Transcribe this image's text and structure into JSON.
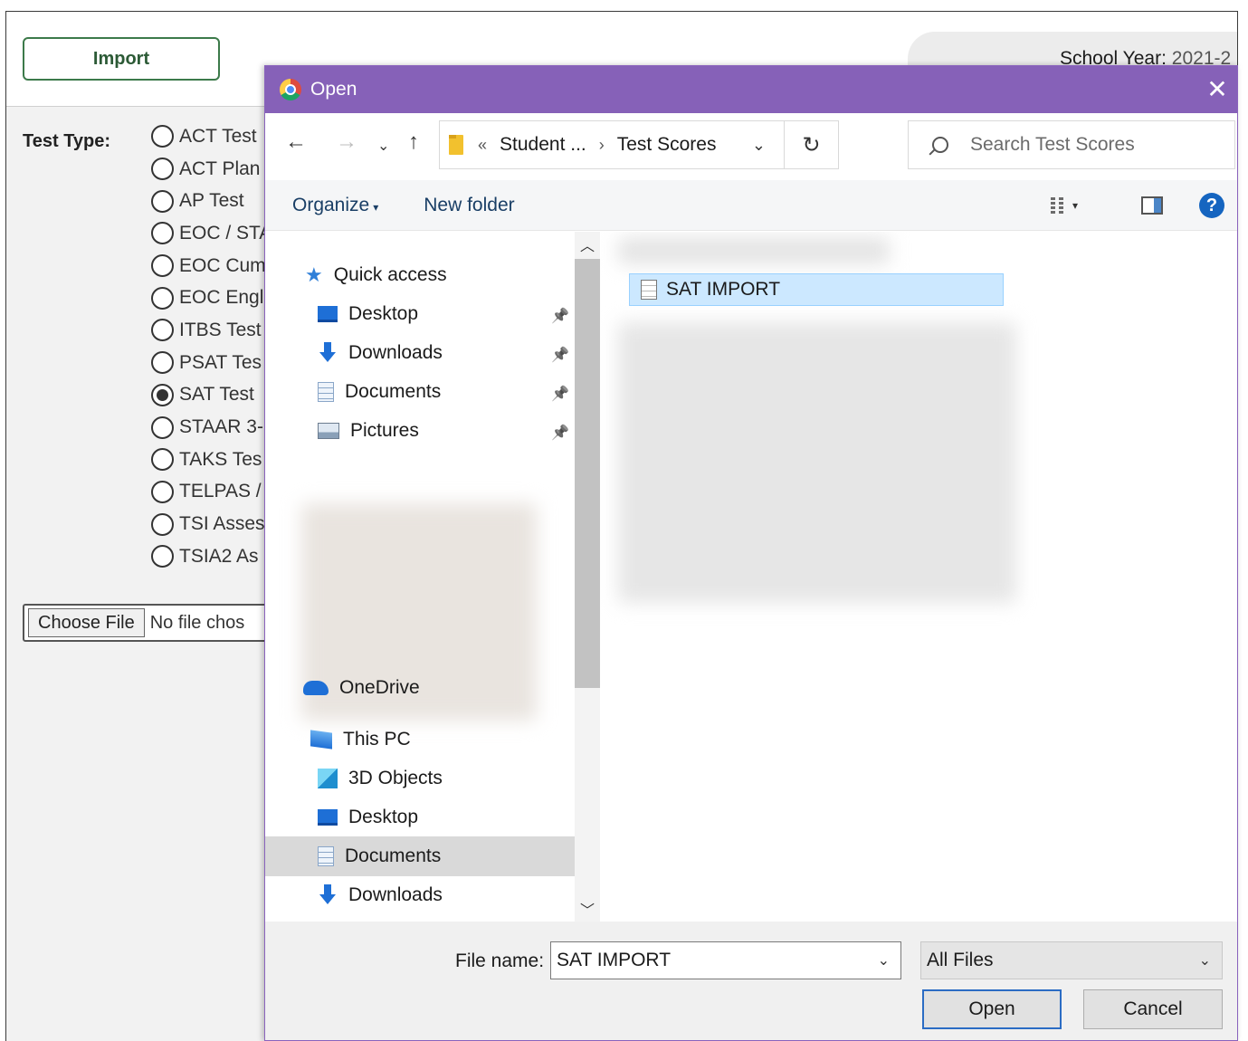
{
  "background_page": {
    "import_button": "Import",
    "school_year_label": "School Year:",
    "school_year_value": "2021-2",
    "test_type_label": "Test Type:",
    "test_types": [
      {
        "label": "ACT Test",
        "selected": false
      },
      {
        "label": "ACT Plan",
        "selected": false
      },
      {
        "label": "AP Test",
        "selected": false
      },
      {
        "label": "EOC / STA",
        "selected": false
      },
      {
        "label": "EOC Cum",
        "selected": false
      },
      {
        "label": "EOC Engl",
        "selected": false
      },
      {
        "label": "ITBS Test",
        "selected": false
      },
      {
        "label": "PSAT Tes",
        "selected": false
      },
      {
        "label": "SAT Test",
        "selected": true
      },
      {
        "label": "STAAR 3-",
        "selected": false
      },
      {
        "label": "TAKS Tes",
        "selected": false
      },
      {
        "label": "TELPAS /",
        "selected": false
      },
      {
        "label": "TSI Asses",
        "selected": false
      },
      {
        "label": "TSIA2 As",
        "selected": false
      }
    ],
    "choose_file_button": "Choose File",
    "no_file_text": "No file chos"
  },
  "dialog": {
    "title": "Open",
    "close_glyph": "✕",
    "address": {
      "back_glyph": "←",
      "forward_glyph": "→",
      "recent_glyph": "⌄",
      "up_glyph": "↑",
      "overflow_glyph": "«",
      "parent_crumb": "Student ...",
      "separator_glyph": "›",
      "current_crumb": "Test Scores",
      "dropdown_glyph": "⌄",
      "refresh_glyph": "↻"
    },
    "search_placeholder": "Search Test Scores",
    "command_bar": {
      "organize": "Organize",
      "organize_caret": "▾",
      "new_folder": "New folder",
      "view_caret": "▾",
      "help_glyph": "?"
    },
    "nav_pane": {
      "quick_access": "Quick access",
      "quick_access_items": [
        {
          "label": "Desktop",
          "icon": "desktop-icon",
          "pinned": true
        },
        {
          "label": "Downloads",
          "icon": "downloads-icon",
          "pinned": true
        },
        {
          "label": "Documents",
          "icon": "documents-icon",
          "pinned": true
        },
        {
          "label": "Pictures",
          "icon": "pictures-icon",
          "pinned": true
        }
      ],
      "pin_glyph": "📌",
      "onedrive": "OneDrive",
      "this_pc": "This PC",
      "this_pc_items": [
        {
          "label": "3D Objects",
          "icon": "3d-objects-icon",
          "selected": false
        },
        {
          "label": "Desktop",
          "icon": "desktop-icon",
          "selected": false
        },
        {
          "label": "Documents",
          "icon": "documents-icon",
          "selected": true
        },
        {
          "label": "Downloads",
          "icon": "downloads-icon",
          "selected": false
        }
      ],
      "scroll_up_glyph": "︿",
      "scroll_down_glyph": "﹀"
    },
    "files": [
      {
        "name": "SAT IMPORT",
        "selected": true
      }
    ],
    "file_name_label": "File name:",
    "file_name_value": "SAT IMPORT",
    "file_type_value": "All Files",
    "dropdown_glyph": "⌄",
    "open_button": "Open",
    "cancel_button": "Cancel"
  },
  "colors": {
    "title_bar": "#8661b8",
    "selection": "#cce8ff",
    "accent": "#1e6fd6",
    "import_border": "#3c7a4a"
  }
}
